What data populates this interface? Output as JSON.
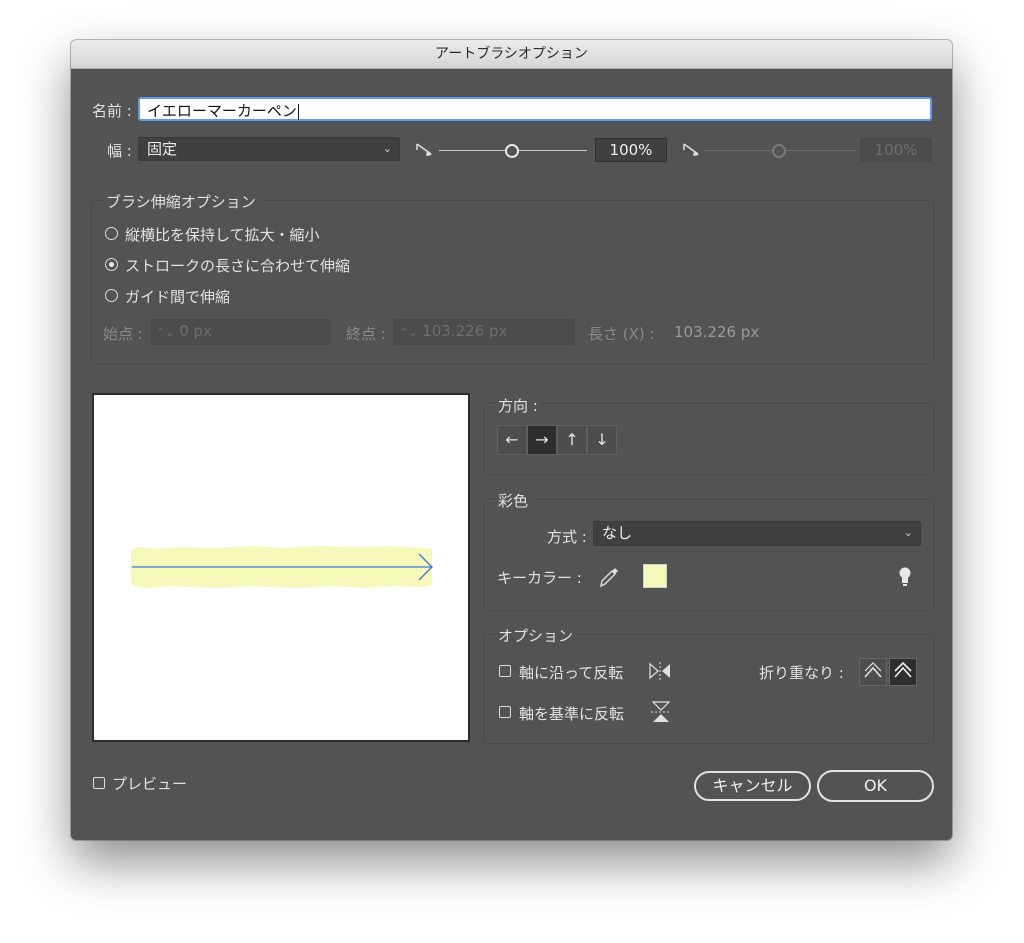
{
  "window": {
    "title": "アートブラシオプション"
  },
  "name": {
    "label": "名前 :",
    "value": "イエローマーカーペン"
  },
  "width": {
    "label": "幅 :",
    "selected": "固定",
    "min_percent": "100%",
    "max_percent": "100%",
    "slider_level_percent": 100
  },
  "scale_options": {
    "title": "ブラシ伸縮オプション",
    "options": [
      {
        "label": "縦横比を保持して拡大・縮小",
        "selected": false
      },
      {
        "label": "ストロークの長さに合わせて伸縮",
        "selected": true
      },
      {
        "label": "ガイド間で伸縮",
        "selected": false
      }
    ],
    "start_label": "始点 :",
    "start_value": "0 px",
    "end_label": "終点 :",
    "end_value": "103.226 px",
    "length_label": "長さ (X) :",
    "length_value": "103.226 px"
  },
  "direction": {
    "title": "方向 :",
    "buttons": [
      "←",
      "→",
      "↑",
      "↓"
    ],
    "selected_index": 1
  },
  "colorization": {
    "title": "彩色",
    "method_label": "方式 :",
    "method_value": "なし",
    "key_color_label": "キーカラー :",
    "key_color_hex": "#f6f8b9",
    "tip_icon": "lightbulb-icon"
  },
  "options": {
    "title": "オプション",
    "flip_along_label": "軸に沿って反転",
    "flip_along_checked": false,
    "flip_across_label": "軸を基準に反転",
    "flip_across_checked": false,
    "overlap_label": "折り重なり :",
    "overlap_selected_index": 1
  },
  "preview": {
    "label": "プレビュー",
    "checked": false,
    "stroke_color": "#f6f8b9",
    "arrow_color": "#3f74d8"
  },
  "buttons": {
    "cancel": "キャンセル",
    "ok": "OK"
  },
  "colors": {
    "dialog_bg": "#535353",
    "accent": "#5e9ee8"
  }
}
